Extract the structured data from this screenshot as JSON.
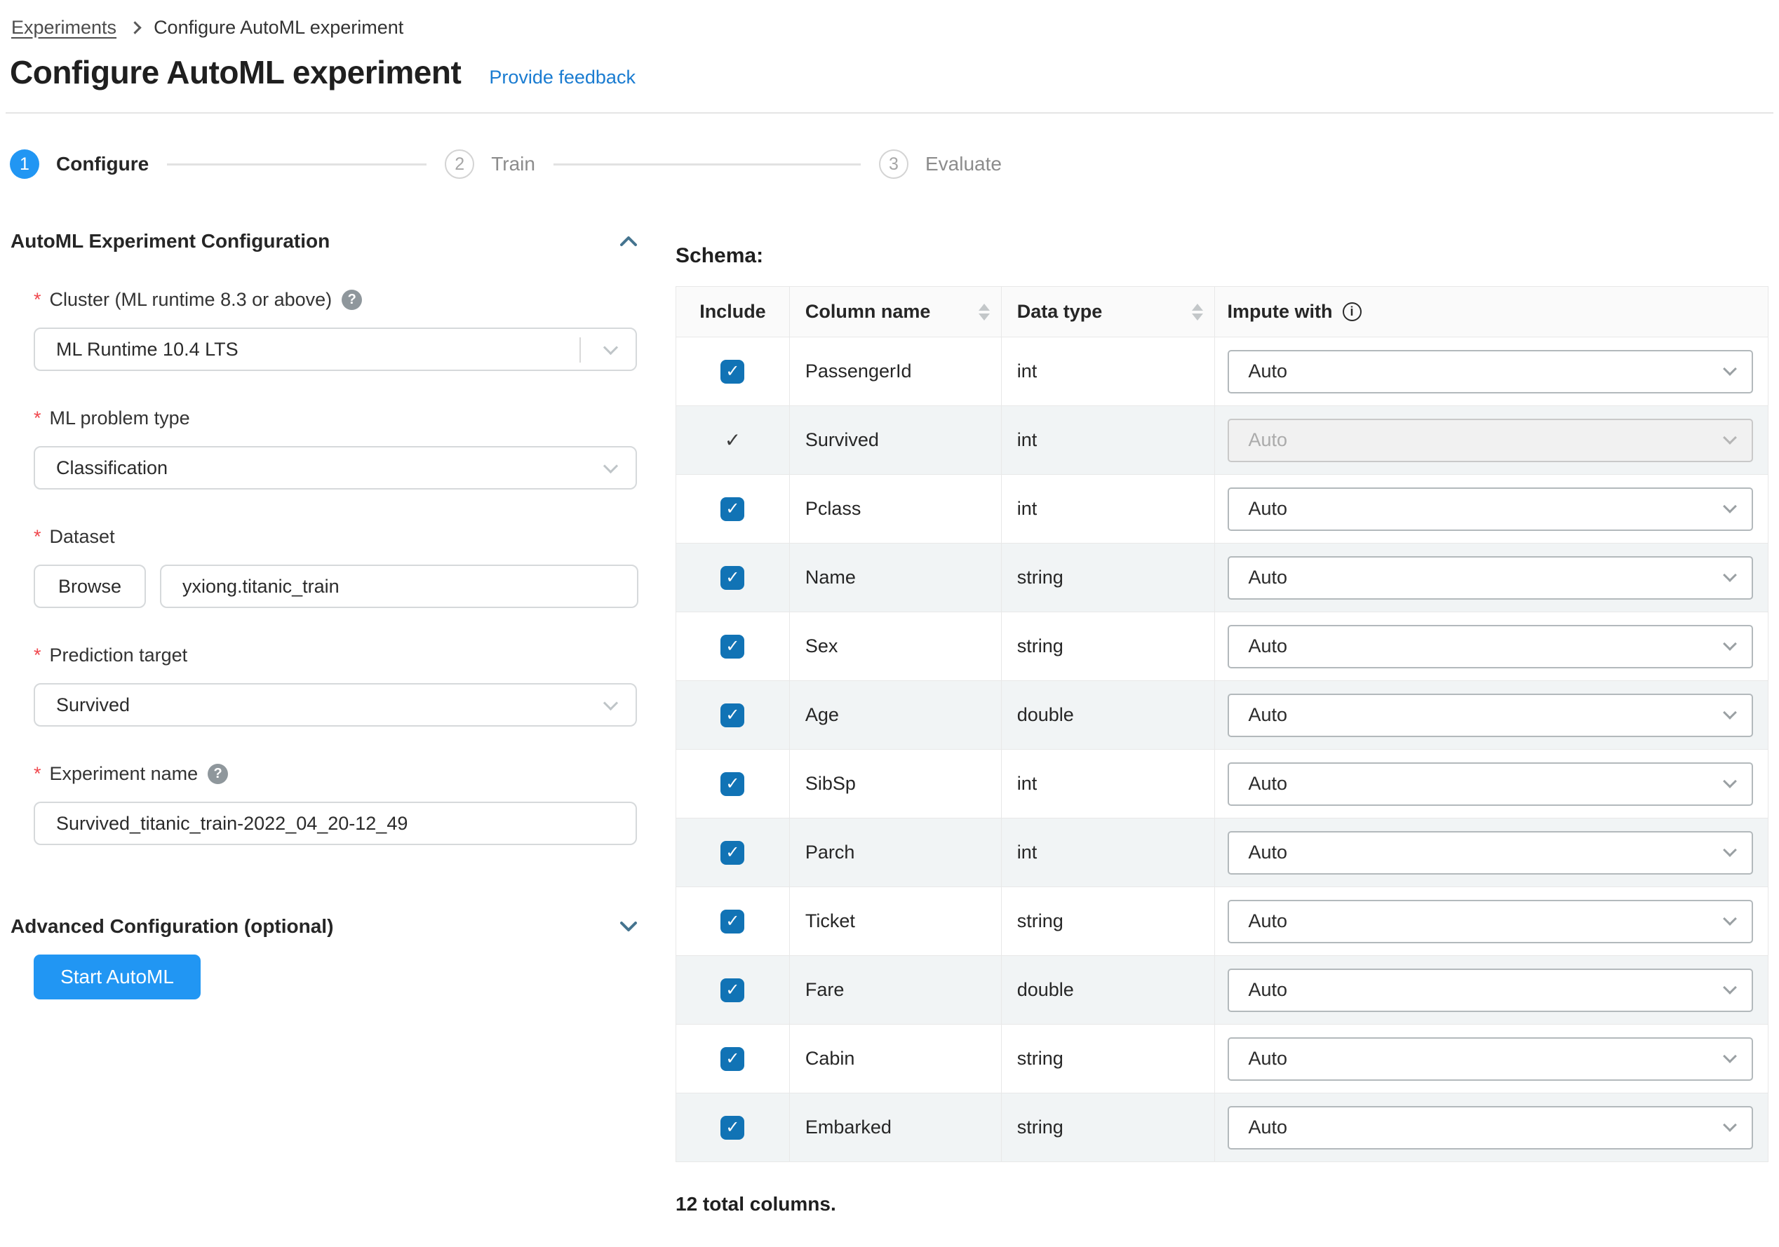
{
  "breadcrumb": {
    "items": [
      {
        "label": "Experiments"
      },
      {
        "label": "Configure AutoML experiment"
      }
    ]
  },
  "header": {
    "title": "Configure AutoML experiment",
    "feedback_link": "Provide feedback"
  },
  "stepper": {
    "steps": [
      {
        "number": "1",
        "label": "Configure",
        "state": "active"
      },
      {
        "number": "2",
        "label": "Train",
        "state": "upcoming"
      },
      {
        "number": "3",
        "label": "Evaluate",
        "state": "upcoming"
      }
    ]
  },
  "form": {
    "section_title": "AutoML Experiment Configuration",
    "required_marker": "*",
    "cluster": {
      "label": "Cluster (ML runtime 8.3 or above)",
      "value": "ML Runtime 10.4 LTS"
    },
    "problem_type": {
      "label": "ML problem type",
      "value": "Classification"
    },
    "dataset": {
      "label": "Dataset",
      "browse_label": "Browse",
      "value": "yxiong.titanic_train"
    },
    "prediction_target": {
      "label": "Prediction target",
      "value": "Survived"
    },
    "experiment_name": {
      "label": "Experiment name",
      "value": "Survived_titanic_train-2022_04_20-12_49"
    },
    "advanced_title": "Advanced Configuration (optional)",
    "start_button": "Start AutoML"
  },
  "schema": {
    "title": "Schema:",
    "columns": {
      "include": "Include",
      "name": "Column name",
      "type": "Data type",
      "impute": "Impute with"
    },
    "rows": [
      {
        "name": "PassengerId",
        "type": "int",
        "impute": "Auto",
        "included": true,
        "forced": false,
        "impute_disabled": false
      },
      {
        "name": "Survived",
        "type": "int",
        "impute": "Auto",
        "included": true,
        "forced": true,
        "impute_disabled": true
      },
      {
        "name": "Pclass",
        "type": "int",
        "impute": "Auto",
        "included": true,
        "forced": false,
        "impute_disabled": false
      },
      {
        "name": "Name",
        "type": "string",
        "impute": "Auto",
        "included": true,
        "forced": false,
        "impute_disabled": false
      },
      {
        "name": "Sex",
        "type": "string",
        "impute": "Auto",
        "included": true,
        "forced": false,
        "impute_disabled": false
      },
      {
        "name": "Age",
        "type": "double",
        "impute": "Auto",
        "included": true,
        "forced": false,
        "impute_disabled": false
      },
      {
        "name": "SibSp",
        "type": "int",
        "impute": "Auto",
        "included": true,
        "forced": false,
        "impute_disabled": false
      },
      {
        "name": "Parch",
        "type": "int",
        "impute": "Auto",
        "included": true,
        "forced": false,
        "impute_disabled": false
      },
      {
        "name": "Ticket",
        "type": "string",
        "impute": "Auto",
        "included": true,
        "forced": false,
        "impute_disabled": false
      },
      {
        "name": "Fare",
        "type": "double",
        "impute": "Auto",
        "included": true,
        "forced": false,
        "impute_disabled": false
      },
      {
        "name": "Cabin",
        "type": "string",
        "impute": "Auto",
        "included": true,
        "forced": false,
        "impute_disabled": false
      },
      {
        "name": "Embarked",
        "type": "string",
        "impute": "Auto",
        "included": true,
        "forced": false,
        "impute_disabled": false
      }
    ],
    "footer": "12 total columns."
  },
  "icons": {
    "help_glyph": "?",
    "info_glyph": "i",
    "check_glyph": "✓"
  },
  "colors": {
    "primary_blue": "#2196f3",
    "link_blue": "#1a7cd1",
    "checkbox_blue": "#1173b5",
    "required_red": "#f0484e",
    "stripe": "#f1f4f5",
    "chevron_slate": "#45748f"
  }
}
